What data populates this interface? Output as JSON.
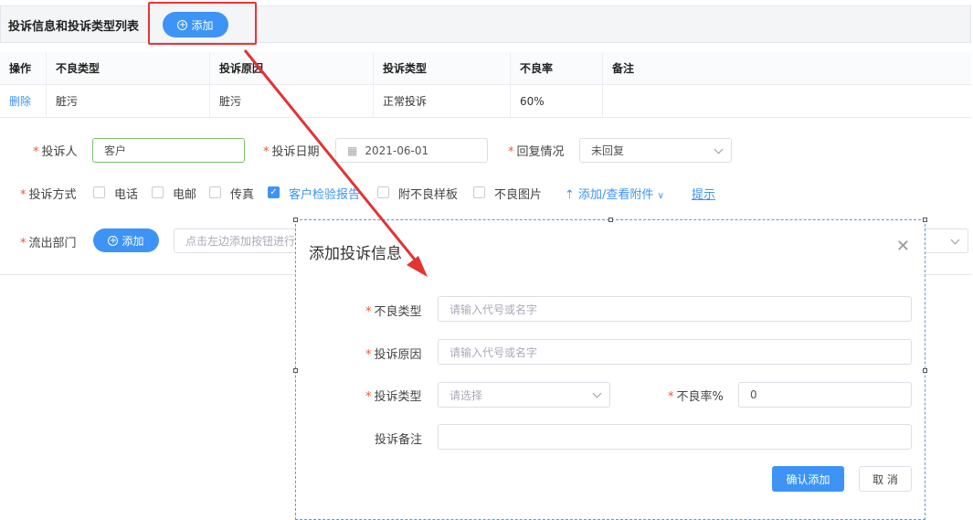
{
  "header": {
    "title": "投诉信息和投诉类型列表",
    "add_label": "添加"
  },
  "table": {
    "columns": [
      "操作",
      "不良类型",
      "投诉原因",
      "投诉类型",
      "不良率",
      "备注"
    ],
    "rows": [
      {
        "action": "删除",
        "defect_type": "脏污",
        "reason": "脏污",
        "complaint_type": "正常投诉",
        "rate": "60%",
        "note": ""
      }
    ]
  },
  "form": {
    "complainant": {
      "label": "投诉人",
      "value": "客户"
    },
    "date": {
      "label": "投诉日期",
      "value": "2021-06-01"
    },
    "reply": {
      "label": "回复情况",
      "value": "未回复"
    },
    "method": {
      "label": "投诉方式",
      "options": [
        {
          "label": "电话",
          "checked": false
        },
        {
          "label": "电邮",
          "checked": false
        },
        {
          "label": "传真",
          "checked": false
        },
        {
          "label": "客户检验报告",
          "checked": true
        },
        {
          "label": "附不良样板",
          "checked": false
        },
        {
          "label": "不良图片",
          "checked": false
        }
      ],
      "attach_label": "添加/查看附件",
      "hint_label": "提示"
    },
    "dept": {
      "label": "流出部门",
      "add_label": "添加",
      "placeholder": "点击左边添加按钮进行"
    }
  },
  "dialog": {
    "title": "添加投诉信息",
    "defect_type": {
      "label": "不良类型",
      "placeholder": "请输入代号或名字"
    },
    "reason": {
      "label": "投诉原因",
      "placeholder": "请输入代号或名字"
    },
    "type": {
      "label": "投诉类型",
      "placeholder": "请选择"
    },
    "rate": {
      "label": "不良率%",
      "value": "0"
    },
    "note": {
      "label": "投诉备注",
      "value": ""
    },
    "confirm_label": "确认添加",
    "cancel_label": "取 消"
  },
  "colors": {
    "accent": "#3d94f6",
    "highlight": "#e33333",
    "required": "#e55533"
  }
}
